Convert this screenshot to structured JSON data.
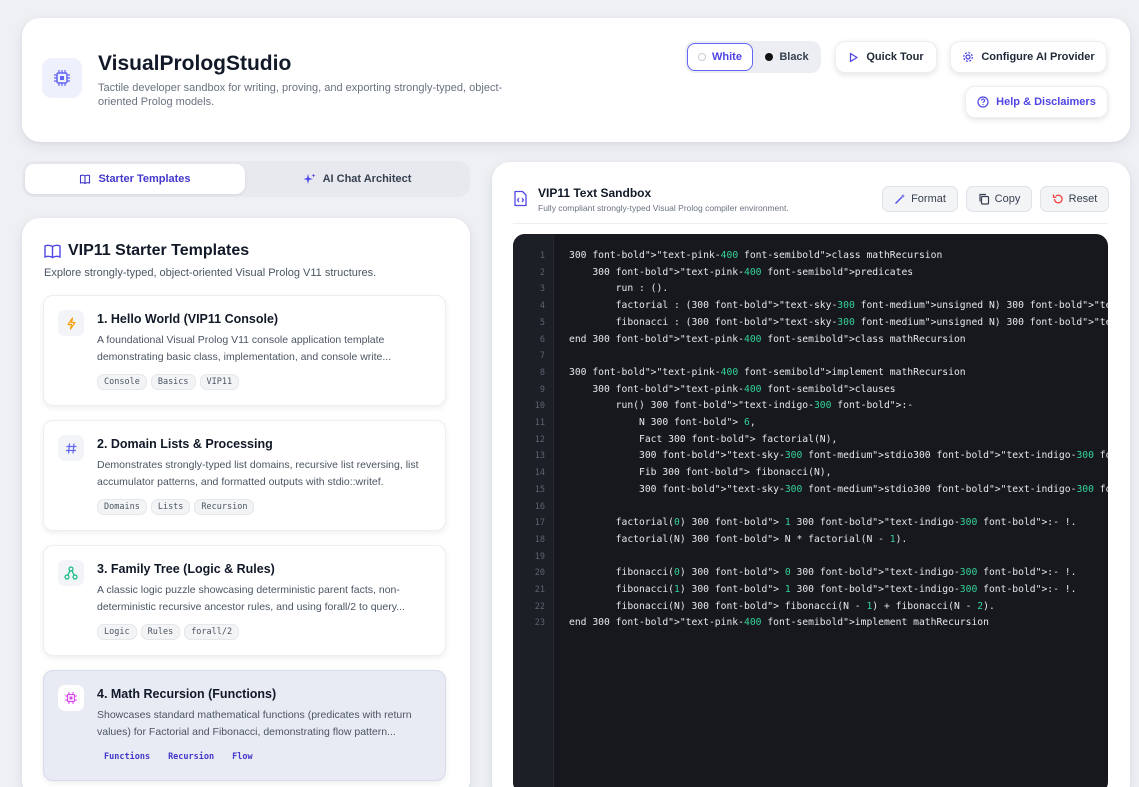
{
  "header": {
    "title": "VisualPrologStudio",
    "subtitle": "Tactile developer sandbox for writing, proving, and exporting strongly-typed, object-oriented Prolog models.",
    "theme": {
      "white_label": "White",
      "black_label": "Black",
      "selected": "White"
    },
    "quick_tour_label": "Quick Tour",
    "configure_label": "Configure AI Provider",
    "help_label": "Help & Disclaimers",
    "logo_icon": "chip-icon"
  },
  "tabs": [
    {
      "label": "Starter Templates",
      "icon": "book-icon",
      "active": true
    },
    {
      "label": "AI Chat Architect",
      "icon": "sparkles-icon",
      "active": false
    }
  ],
  "templates_panel": {
    "title": "VIP11 Starter Templates",
    "subtitle": "Explore strongly-typed, object-oriented Visual Prolog V11 structures.",
    "items": [
      {
        "title": "1. Hello World (VIP11 Console)",
        "description": "A foundational Visual Prolog V11 console application template demonstrating basic class, implementation, and console write...",
        "tags": [
          "Console",
          "Basics",
          "VIP11"
        ],
        "icon": "lightning-icon",
        "icon_color": "#f59e0b"
      },
      {
        "title": "2. Domain Lists & Processing",
        "description": "Demonstrates strongly-typed list domains, recursive list reversing, list accumulator patterns, and formatted outputs with stdio::writef.",
        "tags": [
          "Domains",
          "Lists",
          "Recursion"
        ],
        "icon": "hash-icon",
        "icon_color": "#6366f1"
      },
      {
        "title": "3. Family Tree (Logic & Rules)",
        "description": "A classic logic puzzle showcasing deterministic parent facts, non-deterministic recursive ancestor rules, and using forall/2 to query...",
        "tags": [
          "Logic",
          "Rules",
          "forall/2"
        ],
        "icon": "hierarchy-icon",
        "icon_color": "#10b981"
      },
      {
        "title": "4. Math Recursion (Functions)",
        "description": "Showcases standard mathematical functions (predicates with return values) for Factorial and Fibonacci, demonstrating flow pattern...",
        "tags": [
          "Functions",
          "Recursion",
          "Flow"
        ],
        "icon": "chip-icon",
        "icon_color": "#d946ef",
        "selected": true
      }
    ]
  },
  "sandbox": {
    "title": "VIP11 Text Sandbox",
    "subtitle": "Fully compliant strongly-typed Visual Prolog compiler environment.",
    "format_label": "Format",
    "copy_label": "Copy",
    "reset_label": "Reset",
    "code_lines": [
      "300 font-bold\">\"text-pink-400 font-semibold\">class mathRecursion",
      "    300 font-bold\">\"text-pink-400 font-semibold\">predicates",
      "        run : ().",
      "        factorial : (300 font-bold\">\"text-sky-300 font-medium\">unsigned N) 300 font-bold\">\"text-sky-300 font-medium\">unsigned.",
      "        fibonacci : (300 font-bold\">\"text-sky-300 font-medium\">unsigned N) 300 font-bold\">\"text-sky-300 font-medium\">unsigned.",
      "end 300 font-bold\">\"text-pink-400 font-semibold\">class mathRecursion",
      "",
      "300 font-bold\">\"text-pink-400 font-semibold\">implement mathRecursion",
      "    300 font-bold\">\"text-pink-400 font-semibold\">clauses",
      "        run() 300 font-bold\">\"text-indigo-300 font-bold\">:-",
      "            N 300 font-bold\"> 6,",
      "            Fact 300 font-bold\"> factorial(N),",
      "            300 font-bold\">\"text-sky-300 font-medium\">stdio300 font-bold\">\"text-indigo-300 font-bold\">::write(Fact),",
      "            Fib 300 font-bold\"> fibonacci(N),",
      "            300 font-bold\">\"text-sky-300 font-medium\">stdio300 font-bold\">\"text-indigo-300 font-bold\">::write(Fib).",
      "",
      "        factorial(0) 300 font-bold\"> 1 300 font-bold\">\"text-indigo-300 font-bold\">:- !.",
      "        factorial(N) 300 font-bold\"> N * factorial(N - 1).",
      "",
      "        fibonacci(0) 300 font-bold\"> 0 300 font-bold\">\"text-indigo-300 font-bold\">:- !.",
      "        fibonacci(1) 300 font-bold\"> 1 300 font-bold\">\"text-indigo-300 font-bold\">:- !.",
      "        fibonacci(N) 300 font-bold\"> fibonacci(N - 1) + fibonacci(N - 2).",
      "end 300 font-bold\">\"text-pink-400 font-semibold\">implement mathRecursion"
    ]
  }
}
